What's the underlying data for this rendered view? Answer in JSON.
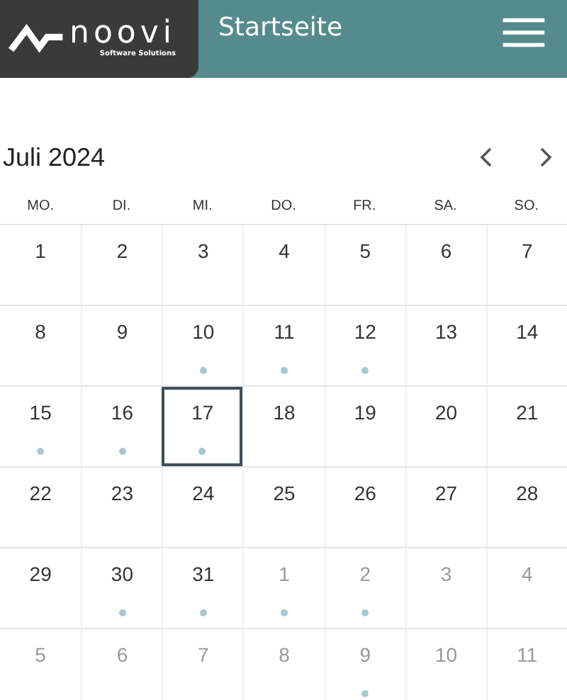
{
  "header": {
    "logo": {
      "name": "noovi",
      "tagline": "Software Solutions"
    },
    "title": "Startseite"
  },
  "calendar": {
    "month": "Juli 2024",
    "weekdays": [
      "MO.",
      "DI.",
      "MI.",
      "DO.",
      "FR.",
      "SA.",
      "SO."
    ],
    "weeks": [
      {
        "days": [
          {
            "label": "1",
            "other_month": false,
            "event": false,
            "selected": false
          },
          {
            "label": "2",
            "other_month": false,
            "event": false,
            "selected": false
          },
          {
            "label": "3",
            "other_month": false,
            "event": false,
            "selected": false
          },
          {
            "label": "4",
            "other_month": false,
            "event": false,
            "selected": false
          },
          {
            "label": "5",
            "other_month": false,
            "event": false,
            "selected": false
          },
          {
            "label": "6",
            "other_month": false,
            "event": false,
            "selected": false
          },
          {
            "label": "7",
            "other_month": false,
            "event": false,
            "selected": false
          }
        ]
      },
      {
        "days": [
          {
            "label": "8",
            "other_month": false,
            "event": false,
            "selected": false
          },
          {
            "label": "9",
            "other_month": false,
            "event": false,
            "selected": false
          },
          {
            "label": "10",
            "other_month": false,
            "event": true,
            "selected": false
          },
          {
            "label": "11",
            "other_month": false,
            "event": true,
            "selected": false
          },
          {
            "label": "12",
            "other_month": false,
            "event": true,
            "selected": false
          },
          {
            "label": "13",
            "other_month": false,
            "event": false,
            "selected": false
          },
          {
            "label": "14",
            "other_month": false,
            "event": false,
            "selected": false
          }
        ]
      },
      {
        "days": [
          {
            "label": "15",
            "other_month": false,
            "event": true,
            "selected": false
          },
          {
            "label": "16",
            "other_month": false,
            "event": true,
            "selected": false
          },
          {
            "label": "17",
            "other_month": false,
            "event": true,
            "selected": true
          },
          {
            "label": "18",
            "other_month": false,
            "event": false,
            "selected": false
          },
          {
            "label": "19",
            "other_month": false,
            "event": false,
            "selected": false
          },
          {
            "label": "20",
            "other_month": false,
            "event": false,
            "selected": false
          },
          {
            "label": "21",
            "other_month": false,
            "event": false,
            "selected": false
          }
        ]
      },
      {
        "days": [
          {
            "label": "22",
            "other_month": false,
            "event": false,
            "selected": false
          },
          {
            "label": "23",
            "other_month": false,
            "event": false,
            "selected": false
          },
          {
            "label": "24",
            "other_month": false,
            "event": false,
            "selected": false
          },
          {
            "label": "25",
            "other_month": false,
            "event": false,
            "selected": false
          },
          {
            "label": "26",
            "other_month": false,
            "event": false,
            "selected": false
          },
          {
            "label": "27",
            "other_month": false,
            "event": false,
            "selected": false
          },
          {
            "label": "28",
            "other_month": false,
            "event": false,
            "selected": false
          }
        ]
      },
      {
        "days": [
          {
            "label": "29",
            "other_month": false,
            "event": false,
            "selected": false
          },
          {
            "label": "30",
            "other_month": false,
            "event": true,
            "selected": false
          },
          {
            "label": "31",
            "other_month": false,
            "event": true,
            "selected": false
          },
          {
            "label": "1",
            "other_month": true,
            "event": true,
            "selected": false
          },
          {
            "label": "2",
            "other_month": true,
            "event": true,
            "selected": false
          },
          {
            "label": "3",
            "other_month": true,
            "event": false,
            "selected": false
          },
          {
            "label": "4",
            "other_month": true,
            "event": false,
            "selected": false
          }
        ]
      },
      {
        "days": [
          {
            "label": "5",
            "other_month": true,
            "event": false,
            "selected": false
          },
          {
            "label": "6",
            "other_month": true,
            "event": false,
            "selected": false
          },
          {
            "label": "7",
            "other_month": true,
            "event": false,
            "selected": false
          },
          {
            "label": "8",
            "other_month": true,
            "event": false,
            "selected": false
          },
          {
            "label": "9",
            "other_month": true,
            "event": true,
            "selected": false
          },
          {
            "label": "10",
            "other_month": true,
            "event": false,
            "selected": false
          },
          {
            "label": "11",
            "other_month": true,
            "event": false,
            "selected": false
          }
        ]
      }
    ]
  }
}
